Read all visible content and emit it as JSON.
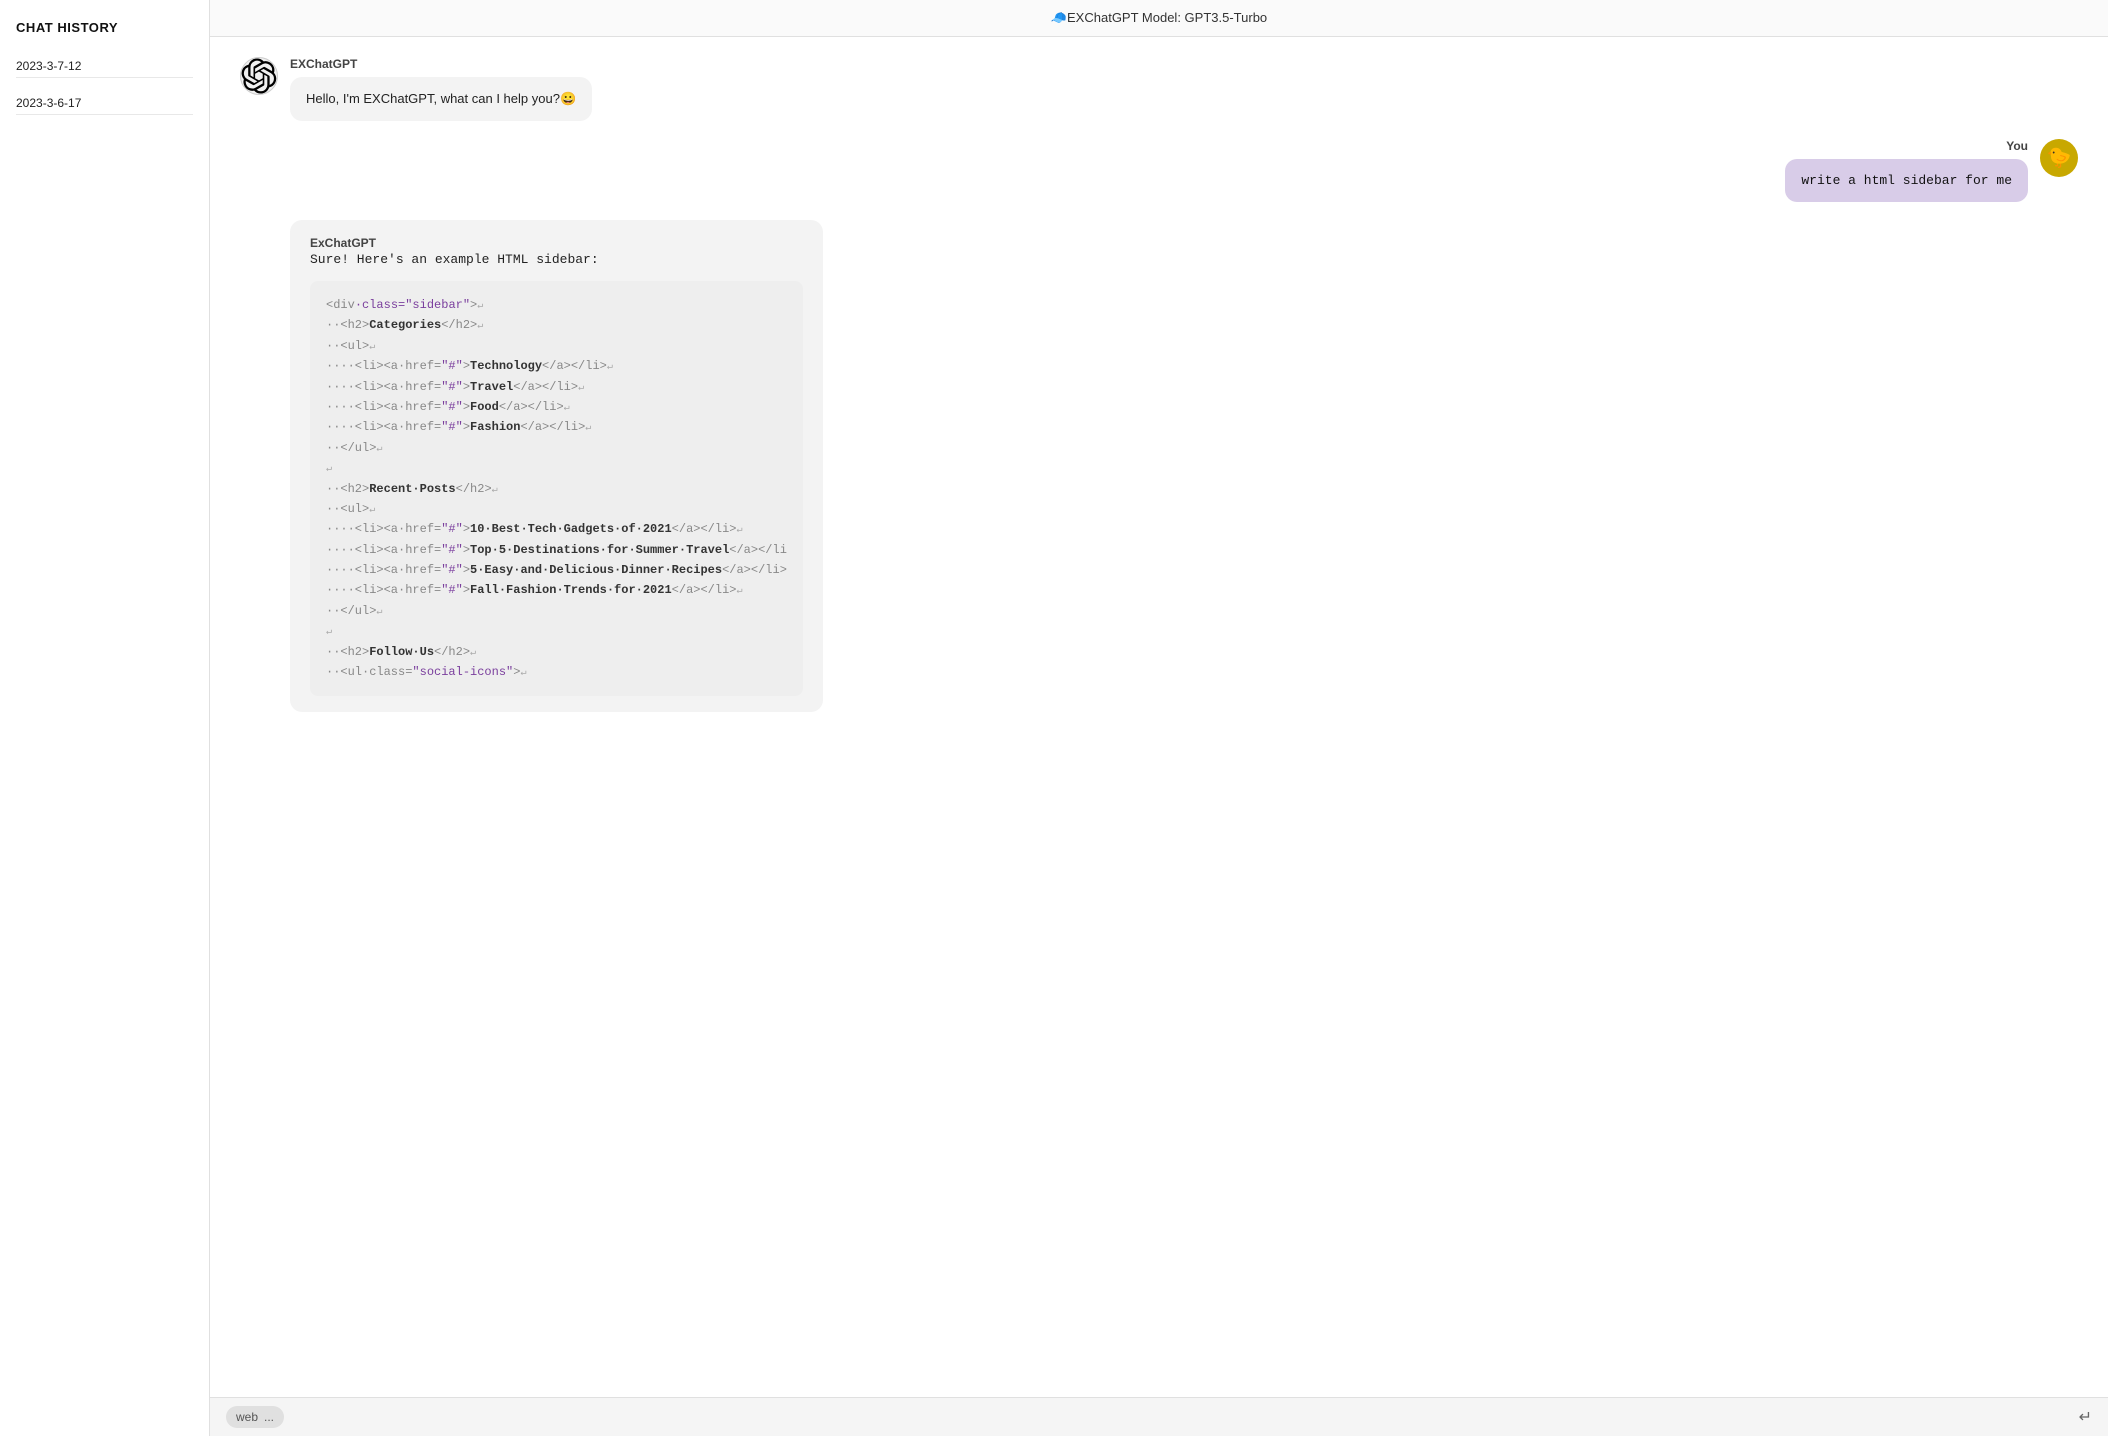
{
  "titlebar": {
    "text": "🧢EXChatGPT Model: GPT3.5-Turbo"
  },
  "sidebar": {
    "title": "CHAT HISTORY",
    "items": [
      {
        "label": "2023-3-7-12"
      },
      {
        "label": "2023-3-6-17"
      }
    ]
  },
  "messages": [
    {
      "id": "bot-greeting",
      "sender": "EXChatGPT",
      "type": "text",
      "text": "Hello, I'm EXChatGPT, what can I help you?😀",
      "role": "bot"
    },
    {
      "id": "user-msg",
      "sender": "You",
      "type": "text",
      "text": "write a html sidebar for me",
      "role": "user"
    },
    {
      "id": "bot-code",
      "sender": "ExChatGPT",
      "type": "code",
      "intro": "Sure! Here's an example HTML sidebar:",
      "role": "bot"
    }
  ],
  "code_block": {
    "lines": [
      "<div·class=\"sidebar\">↵",
      "··<h2>Categories</h2>↵",
      "··<ul>↵",
      "····<li><a·href=\"#\">Technology</a></li>↵",
      "····<li><a·href=\"#\">Travel</a></li>↵",
      "····<li><a·href=\"#\">Food</a></li>↵",
      "····<li><a·href=\"#\">Fashion</a></li>↵",
      "··</ul>↵",
      "↵",
      "··<h2>Recent·Posts</h2>↵",
      "··<ul>↵",
      "····<li><a·href=\"#\">10·Best·Tech·Gadgets·of·2021</a></li>↵",
      "····<li><a·href=\"#\">Top·5·Destinations·for·Summer·Travel</a></li",
      "····<li><a·href=\"#\">5·Easy·and·Delicious·Dinner·Recipes</a></li>",
      "····<li><a·href=\"#\">Fall·Fashion·Trends·for·2021</a></li>↵",
      "··</ul>↵",
      "↵",
      "··<h2>Follow·Us</h2>↵",
      "··<ul·class=\"social-icons\">↵"
    ]
  },
  "input_bar": {
    "web_badge": "web",
    "web_dots": "...",
    "placeholder": "",
    "send_label": "↵"
  },
  "icons": {
    "openai": "openai-logo",
    "user_avatar": "🐤"
  }
}
